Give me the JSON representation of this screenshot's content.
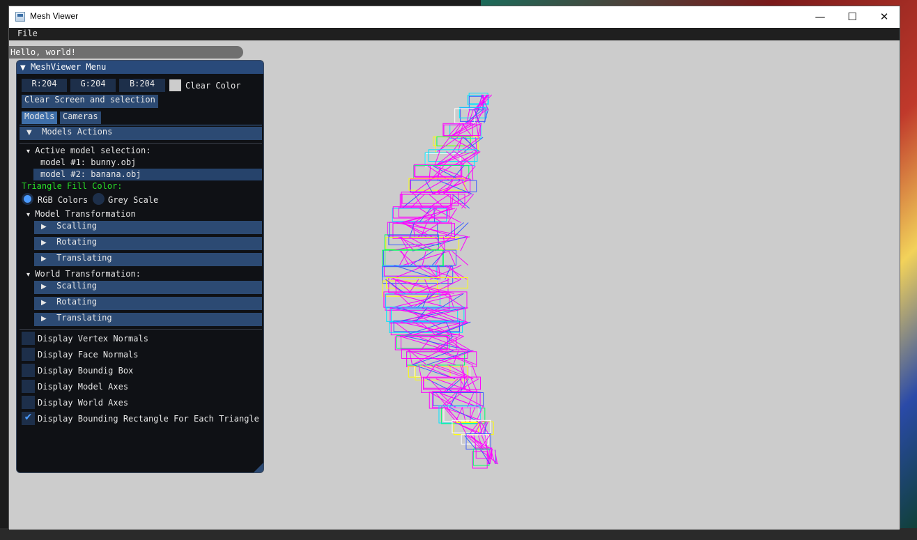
{
  "window": {
    "title": "Mesh Viewer",
    "minimize": "—",
    "maximize": "☐",
    "close": "✕"
  },
  "menubar": {
    "file": "File"
  },
  "overlay": {
    "hello": "Hello, world!"
  },
  "panel": {
    "title": "MeshViewer Menu",
    "color_r": "R:204",
    "color_g": "G:204",
    "color_b": "B:204",
    "clear_color_label": "Clear Color",
    "clear_button": "Clear Screen and selection",
    "tabs": [
      "Models",
      "Cameras"
    ],
    "models_actions": "Models Actions",
    "active_selection": "Active model selection:",
    "models": [
      "model #1: bunny.obj",
      "model #2: banana.obj"
    ],
    "fill_color_label": "Triangle Fill Color:",
    "fill_color_hex": "#28e028",
    "radio_rgb": "RGB Colors",
    "radio_grey": "Grey Scale",
    "model_transformation": "Model Transformation",
    "world_transformation": "World Transformation:",
    "transform_items": [
      "Scalling",
      "Rotating",
      "Translating"
    ],
    "checkboxes": [
      {
        "label": "Display Vertex Normals",
        "checked": false
      },
      {
        "label": "Display Face Normals",
        "checked": false
      },
      {
        "label": "Display Boundig Box",
        "checked": false
      },
      {
        "label": "Display Model Axes",
        "checked": false
      },
      {
        "label": "Display World Axes",
        "checked": false
      },
      {
        "label": "Display Bounding Rectangle For Each Triangle",
        "checked": true
      }
    ]
  },
  "colors": {
    "viewport_bg": "#cccccc",
    "accent": "#2c4a73",
    "mesh_magenta": "#ff00ff",
    "mesh_blue": "#3a5bff",
    "mesh_cyan": "#00e5ff"
  }
}
